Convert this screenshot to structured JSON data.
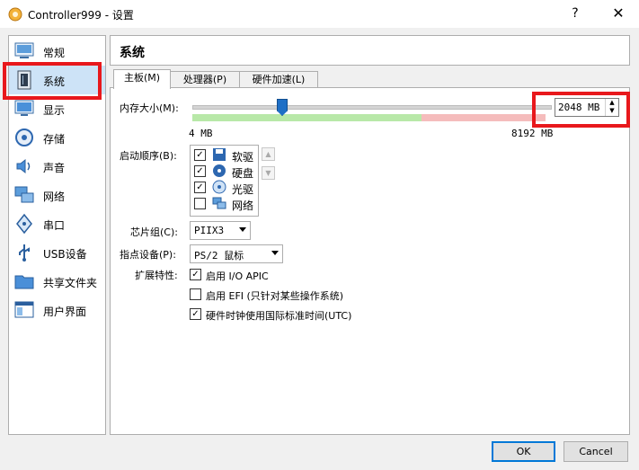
{
  "window": {
    "title": "Controller999 - 设置",
    "help_glyph": "?",
    "close_glyph": "✕"
  },
  "sidebar": {
    "items": [
      {
        "label": "常规",
        "icon": "general-icon"
      },
      {
        "label": "系统",
        "icon": "system-icon",
        "selected": true
      },
      {
        "label": "显示",
        "icon": "display-icon"
      },
      {
        "label": "存储",
        "icon": "storage-icon"
      },
      {
        "label": "声音",
        "icon": "audio-icon"
      },
      {
        "label": "网络",
        "icon": "network-icon"
      },
      {
        "label": "串口",
        "icon": "serial-port-icon"
      },
      {
        "label": "USB设备",
        "icon": "usb-icon"
      },
      {
        "label": "共享文件夹",
        "icon": "shared-folder-icon"
      },
      {
        "label": "用户界面",
        "icon": "user-interface-icon"
      }
    ]
  },
  "section": {
    "title": "系统"
  },
  "tabs": [
    {
      "label": "主板(M)",
      "active": true
    },
    {
      "label": "处理器(P)",
      "active": false
    },
    {
      "label": "硬件加速(L)",
      "active": false
    }
  ],
  "motherboard": {
    "memory_label": "内存大小(M):",
    "memory_value": "2048 MB",
    "memory_fraction": 0.25,
    "memory_min_label": "4 MB",
    "memory_max_label": "8192 MB",
    "boot_order_label": "启动顺序(B):",
    "boot_items": [
      {
        "label": "软驱",
        "checked": true,
        "icon": "floppy-icon"
      },
      {
        "label": "硬盘",
        "checked": true,
        "icon": "hard-disk-icon"
      },
      {
        "label": "光驱",
        "checked": true,
        "icon": "optical-drive-icon"
      },
      {
        "label": "网络",
        "checked": false,
        "icon": "network-boot-icon"
      }
    ],
    "chipset_label": "芯片组(C):",
    "chipset_value": "PIIX3",
    "pointing_label": "指点设备(P):",
    "pointing_value": "PS/2 鼠标",
    "features_label": "扩展特性:",
    "features": [
      {
        "label": "启用 I/O APIC",
        "checked": true
      },
      {
        "label": "启用 EFI (只针对某些操作系统)",
        "checked": false
      },
      {
        "label": "硬件时钟使用国际标准时间(UTC)",
        "checked": true
      }
    ]
  },
  "buttons": {
    "ok": "OK",
    "cancel": "Cancel"
  },
  "colors": {
    "highlight_red": "#e8181c",
    "slider_green": "#b8e8a8",
    "slider_red": "#f5bcbc",
    "thumb_blue": "#1e6fc6",
    "selection": "#cde3f7"
  }
}
